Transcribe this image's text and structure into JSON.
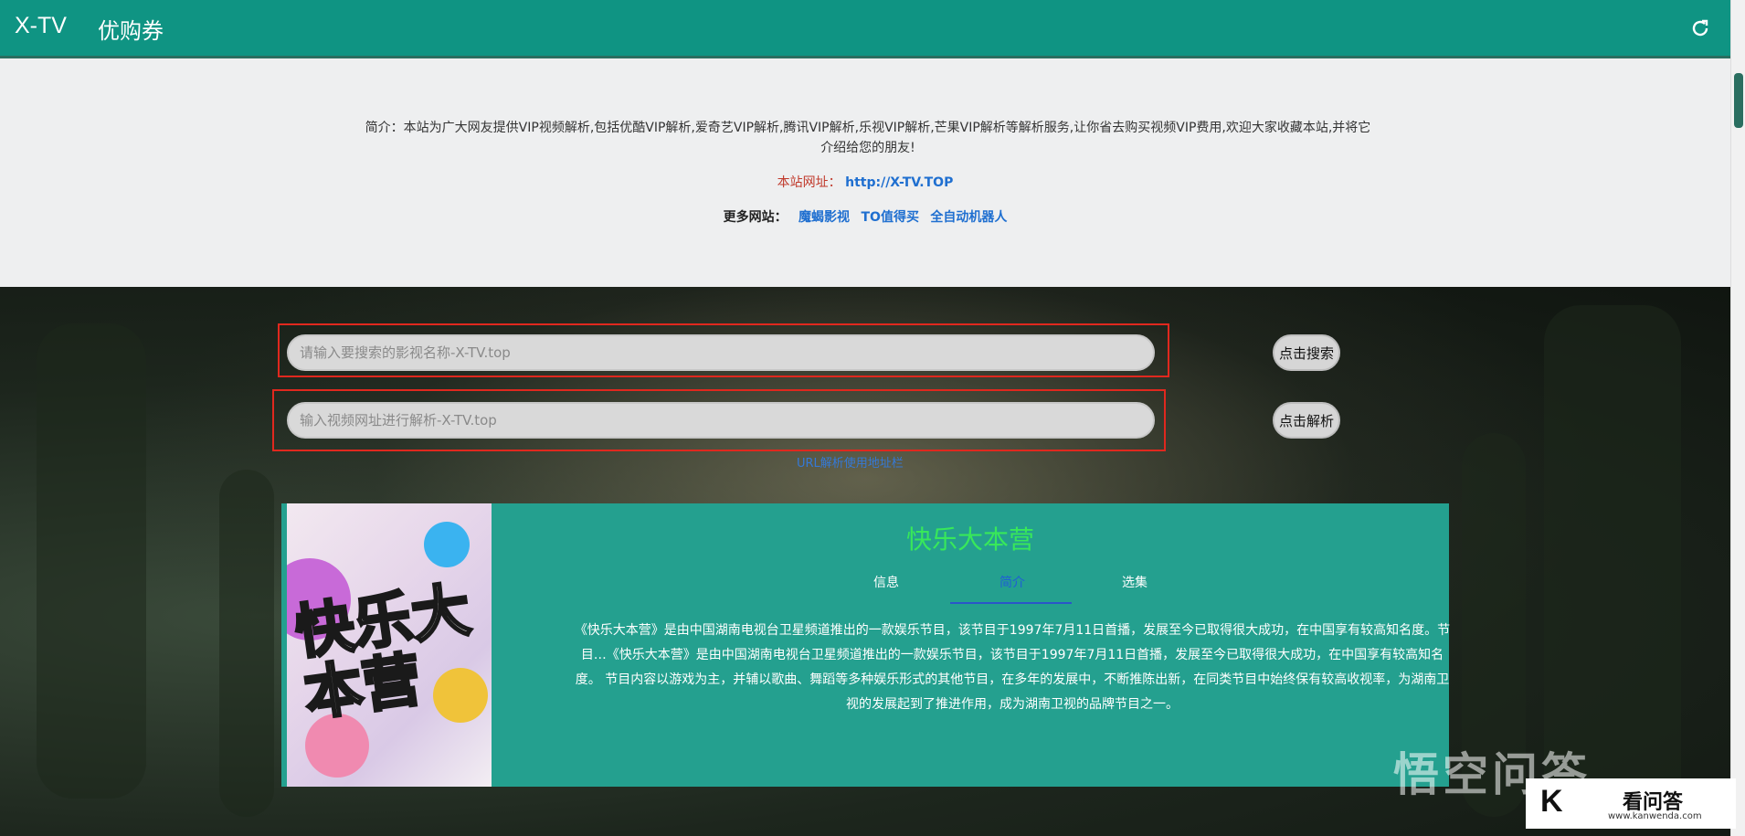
{
  "header": {
    "brand": "X-TV",
    "nav_coupon": "优购券"
  },
  "intro": {
    "description": "简介：本站为广大网友提供VIP视频解析,包括优酷VIP解析,爱奇艺VIP解析,腾讯VIP解析,乐视VIP解析,芒果VIP解析等解析服务,让你省去购买视频VIP费用,欢迎大家收藏本站,并将它介绍给您的朋友!",
    "site_label": "本站网址：",
    "site_url": "http://X-TV.TOP",
    "more_label": "更多网站：",
    "more_links": [
      "魔蝎影视",
      "TO值得买",
      "全自动机器人"
    ]
  },
  "search": {
    "placeholder": "请输入要搜索的影视名称-X-TV.top",
    "button": "点击搜索"
  },
  "parse": {
    "placeholder": "输入视频网址进行解析-X-TV.top",
    "button": "点击解析",
    "hint": "URL解析使用地址栏"
  },
  "card": {
    "title": "快乐大本营",
    "poster_text": "快乐大本营",
    "tabs": [
      "信息",
      "简介",
      "选集"
    ],
    "active_tab": "简介",
    "description": "《快乐大本营》是由中国湖南电视台卫星频道推出的一款娱乐节目，该节目于1997年7月11日首播，发展至今已取得很大成功，在中国享有较高知名度。节目…《快乐大本营》是由中国湖南电视台卫星频道推出的一款娱乐节目，该节目于1997年7月11日首播，发展至今已取得很大成功，在中国享有较高知名度。 节目内容以游戏为主，并辅以歌曲、舞蹈等多种娱乐形式的其他节目，在多年的发展中，不断推陈出新，在同类节目中始终保有较高收视率，为湖南卫视的发展起到了推进作用，成为湖南卫视的品牌节目之一。"
  },
  "watermark": {
    "big": "悟空问答",
    "logo_k": "K",
    "logo_cn": "看问答",
    "logo_url": "www.kanwenda.com"
  },
  "colors": {
    "topbar": "#0f9483",
    "card": "#24a08f",
    "title_green": "#38e85a",
    "link_blue": "#1f6fd0",
    "red_box": "#e0281e"
  }
}
